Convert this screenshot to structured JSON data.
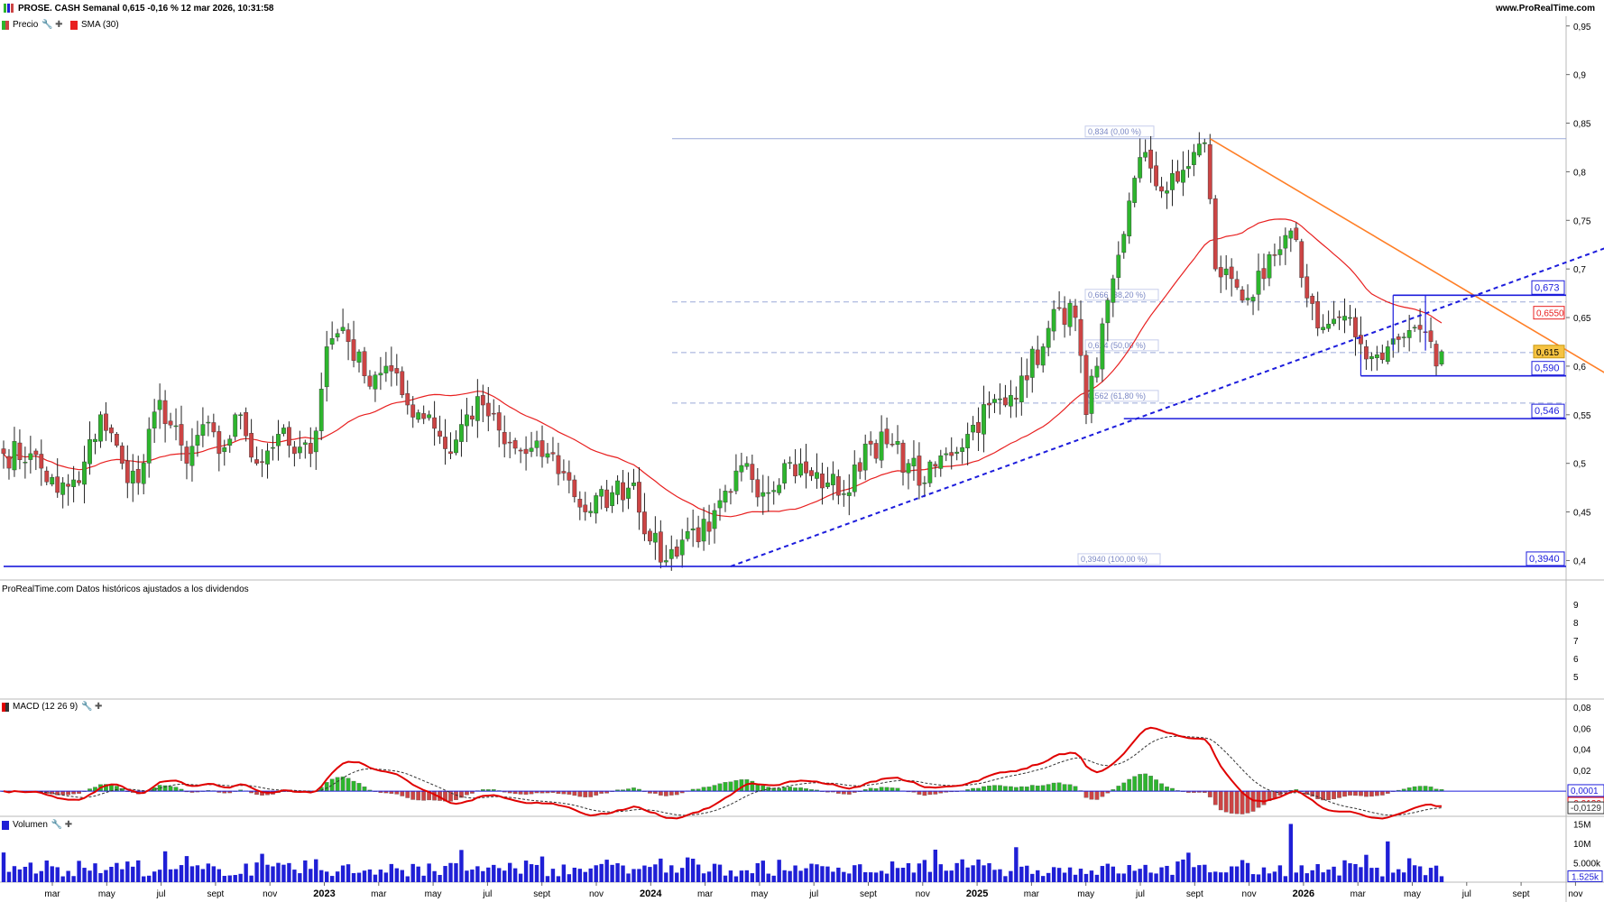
{
  "header": {
    "title": "PROSE. CASH Semanal 0,615 -0,16 % 12 mar 2026, 10:31:58",
    "site": "www.ProRealTime.com"
  },
  "legends": {
    "price": "Precio",
    "sma": "SMA (30)",
    "macd": "MACD (12 26 9)",
    "volume": "Volumen"
  },
  "footnote": "ProRealTime.com  Datos históricos ajustados a los dividendos",
  "colors": {
    "bull": "#2db52d",
    "bear": "#cc4444",
    "sma": "#e82020",
    "trend_down": "#ff7f27",
    "trend_up": "#1c1cdc",
    "level": "#1c1cdc",
    "volume": "#1f1fd6",
    "macd_line": "#e00000",
    "signal_line": "#333333"
  },
  "chart_data": [
    {
      "type": "candlestick",
      "panel": "price",
      "ylim": [
        0.38,
        0.96
      ],
      "y_ticks": [
        "0,95",
        "0,9",
        "0,85",
        "0,8",
        "0,75",
        "0,7",
        "0,65",
        "0,6",
        "0,55",
        "0,5",
        "0,45",
        "0,4"
      ],
      "y_tick_values": [
        0.95,
        0.9,
        0.85,
        0.8,
        0.75,
        0.7,
        0.65,
        0.6,
        0.55,
        0.5,
        0.45,
        0.4
      ],
      "x_labels": [
        "mar",
        "may",
        "jul",
        "sept",
        "nov",
        "2023",
        "mar",
        "may",
        "jul",
        "sept",
        "nov",
        "2024",
        "mar",
        "may",
        "jul",
        "sept",
        "nov",
        "2025",
        "mar",
        "may",
        "jul",
        "sept",
        "nov",
        "2026",
        "mar",
        "may",
        "jul",
        "sept",
        "nov"
      ],
      "bold_x_labels": [
        "2023",
        "2024",
        "2025",
        "2026"
      ],
      "start_week": 0,
      "anchors": [
        [
          0,
          0.51
        ],
        [
          5,
          0.51
        ],
        [
          10,
          0.47
        ],
        [
          14,
          0.48
        ],
        [
          18,
          0.55
        ],
        [
          22,
          0.5
        ],
        [
          25,
          0.48
        ],
        [
          29,
          0.565
        ],
        [
          34,
          0.5
        ],
        [
          37,
          0.54
        ],
        [
          40,
          0.51
        ],
        [
          44,
          0.55
        ],
        [
          47,
          0.5
        ],
        [
          51,
          0.53
        ],
        [
          54,
          0.51
        ],
        [
          57,
          0.51
        ],
        [
          60,
          0.62
        ],
        [
          63,
          0.64
        ],
        [
          67,
          0.59
        ],
        [
          71,
          0.6
        ],
        [
          75,
          0.56
        ],
        [
          79,
          0.55
        ],
        [
          83,
          0.51
        ],
        [
          86,
          0.55
        ],
        [
          89,
          0.56
        ],
        [
          93,
          0.52
        ],
        [
          97,
          0.51
        ],
        [
          101,
          0.51
        ],
        [
          104,
          0.49
        ],
        [
          108,
          0.45
        ],
        [
          113,
          0.47
        ],
        [
          117,
          0.48
        ],
        [
          120,
          0.42
        ],
        [
          123,
          0.4
        ],
        [
          127,
          0.43
        ],
        [
          131,
          0.43
        ],
        [
          135,
          0.47
        ],
        [
          138,
          0.5
        ],
        [
          141,
          0.47
        ],
        [
          145,
          0.5
        ],
        [
          149,
          0.49
        ],
        [
          153,
          0.48
        ],
        [
          157,
          0.47
        ],
        [
          160,
          0.52
        ],
        [
          164,
          0.52
        ],
        [
          168,
          0.5
        ],
        [
          171,
          0.48
        ],
        [
          175,
          0.51
        ],
        [
          179,
          0.53
        ],
        [
          183,
          0.56
        ],
        [
          186,
          0.56
        ],
        [
          189,
          0.59
        ],
        [
          193,
          0.62
        ],
        [
          196,
          0.66
        ],
        [
          199,
          0.65
        ],
        [
          201,
          0.55
        ],
        [
          203,
          0.6
        ],
        [
          206,
          0.69
        ],
        [
          209,
          0.77
        ],
        [
          212,
          0.82
        ],
        [
          215,
          0.78
        ],
        [
          218,
          0.79
        ],
        [
          221,
          0.82
        ],
        [
          223,
          0.83
        ],
        [
          225,
          0.7
        ],
        [
          228,
          0.69
        ],
        [
          231,
          0.67
        ],
        [
          234,
          0.69
        ],
        [
          237,
          0.72
        ],
        [
          240,
          0.73
        ],
        [
          242,
          0.67
        ],
        [
          245,
          0.64
        ],
        [
          248,
          0.65
        ],
        [
          251,
          0.63
        ],
        [
          254,
          0.61
        ],
        [
          257,
          0.62
        ],
        [
          260,
          0.63
        ],
        [
          262,
          0.64
        ],
        [
          264,
          0.635
        ],
        [
          266,
          0.6
        ],
        [
          267,
          0.615
        ]
      ],
      "hlines": [
        {
          "value": 0.834,
          "label": "0,834 (0,00 %)"
        },
        {
          "value": 0.666,
          "label": "0,666 (38,20 %)"
        },
        {
          "value": 0.614,
          "label": "0,614 (50,00 %)"
        },
        {
          "value": 0.562,
          "label": "0,562 (61,80 %)"
        },
        {
          "value": 0.394,
          "label": "0,3940 (100,00 %)"
        }
      ],
      "levels": [
        {
          "value": 0.673,
          "label": "0,673",
          "from_week": 258
        },
        {
          "value": 0.59,
          "label": "0,590",
          "from_week": 252
        },
        {
          "value": 0.546,
          "label": "0,546",
          "from_week": 208
        },
        {
          "value": 0.394,
          "label": "0,3940",
          "from_week": 0
        }
      ],
      "right_tags": [
        {
          "value": 0.655,
          "label": "0,6550",
          "kind": "sma"
        },
        {
          "value": 0.615,
          "label": "0,615",
          "kind": "price"
        }
      ],
      "trendlines": [
        {
          "name": "down",
          "from": [
            224,
            0.834
          ],
          "to": [
            336,
            0.466
          ]
        },
        {
          "name": "up",
          "from": [
            135,
            0.394
          ],
          "to": [
            315,
            0.757
          ]
        }
      ],
      "box": {
        "from_week": 258,
        "to_week": 264,
        "top": 0.673,
        "bottom": 0.616
      }
    },
    {
      "type": "blank",
      "panel": "indicator",
      "y_ticks": [
        "9",
        "8",
        "7",
        "6",
        "5"
      ]
    },
    {
      "type": "macd",
      "panel": "macd",
      "ylim": [
        -0.024,
        0.086
      ],
      "y_ticks": [
        "0,08",
        "0,06",
        "0,04",
        "0,02"
      ],
      "y_tick_values": [
        0.08,
        0.06,
        0.04,
        0.02
      ],
      "tags": [
        {
          "value": 0.0001,
          "label": "0,0001"
        },
        {
          "value": -0.012,
          "label": "-0,0120"
        },
        {
          "value": -0.0129,
          "label": "-0,0129"
        }
      ]
    },
    {
      "type": "bar",
      "panel": "volume",
      "y_ticks": [
        "15M",
        "10M",
        "5.000k"
      ],
      "y_tick_values": [
        15000000,
        10000000,
        5000000
      ],
      "last_value_label": "1.525k",
      "last_value": 1525000,
      "ylim": [
        0,
        16500000
      ]
    }
  ]
}
